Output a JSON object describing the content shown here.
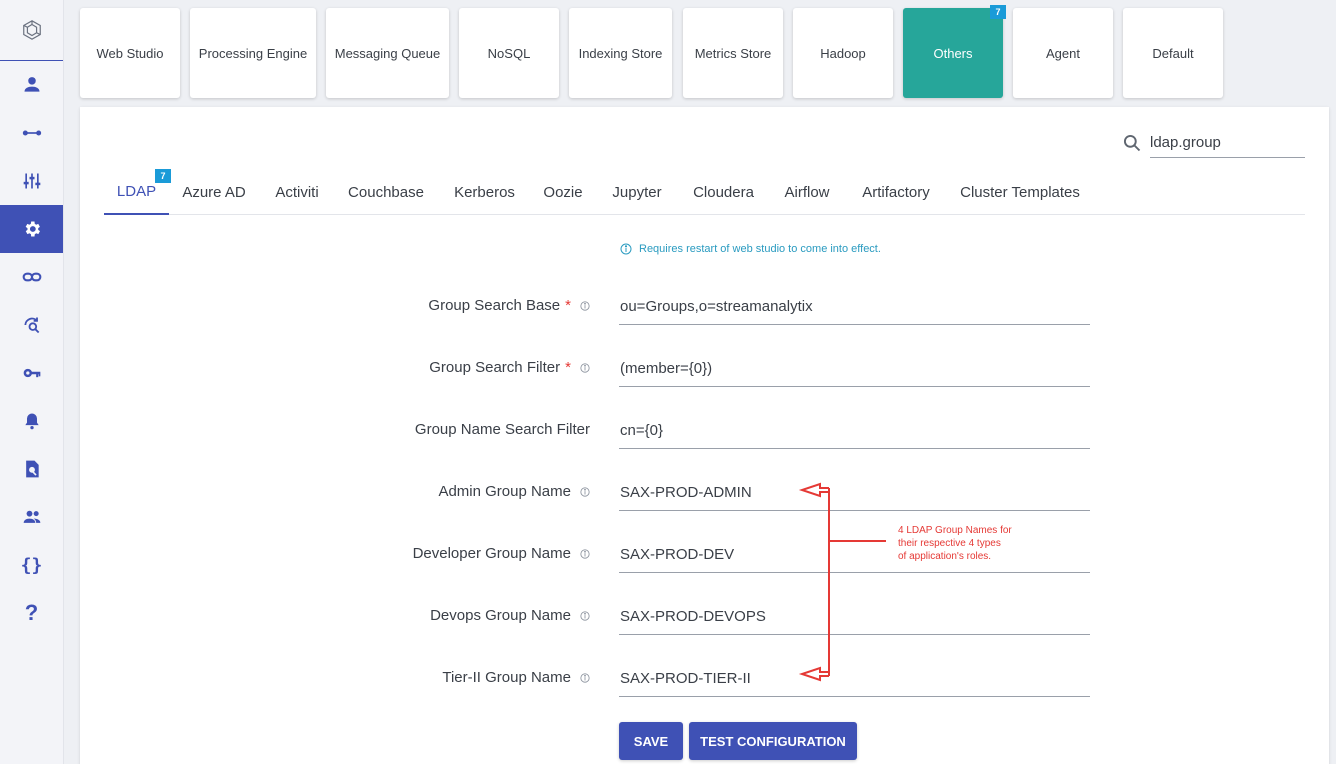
{
  "sidebar": {
    "logo_icon": "hexagon-logo",
    "items": [
      {
        "icon": "user-icon"
      },
      {
        "icon": "pipeline-icon"
      },
      {
        "icon": "sliders-icon"
      },
      {
        "icon": "gear-icon",
        "active": true
      },
      {
        "icon": "link-icon"
      },
      {
        "icon": "refresh-search-icon"
      },
      {
        "icon": "key-icon"
      },
      {
        "icon": "bell-icon"
      },
      {
        "icon": "document-search-icon"
      },
      {
        "icon": "users-icon"
      },
      {
        "icon": "braces-icon"
      },
      {
        "icon": "help-icon"
      }
    ]
  },
  "categories": [
    {
      "label": "Web Studio"
    },
    {
      "label": "Processing Engine"
    },
    {
      "label": "Messaging Queue"
    },
    {
      "label": "NoSQL"
    },
    {
      "label": "Indexing Store"
    },
    {
      "label": "Metrics Store"
    },
    {
      "label": "Hadoop"
    },
    {
      "label": "Others",
      "active": true,
      "badge": "7"
    },
    {
      "label": "Agent"
    },
    {
      "label": "Default"
    }
  ],
  "search": {
    "value": "ldap.group"
  },
  "tabs": [
    {
      "label": "LDAP",
      "active": true,
      "badge": "7"
    },
    {
      "label": "Azure AD"
    },
    {
      "label": "Activiti"
    },
    {
      "label": "Couchbase"
    },
    {
      "label": "Kerberos"
    },
    {
      "label": "Oozie"
    },
    {
      "label": "Jupyter"
    },
    {
      "label": "Cloudera"
    },
    {
      "label": "Airflow"
    },
    {
      "label": "Artifactory"
    },
    {
      "label": "Cluster Templates"
    }
  ],
  "notice": "Requires restart of web studio to come into effect.",
  "fields": [
    {
      "label": "Group Search Base",
      "required": "*",
      "value": "ou=Groups,o=streamanalytix"
    },
    {
      "label": "Group Search Filter",
      "required": "*",
      "value": "(member={0})"
    },
    {
      "label": "Group Name Search Filter",
      "value": "cn={0}"
    },
    {
      "label": "Admin Group Name",
      "value": "SAX-PROD-ADMIN"
    },
    {
      "label": "Developer Group Name",
      "value": "SAX-PROD-DEV"
    },
    {
      "label": "Devops Group Name",
      "value": "SAX-PROD-DEVOPS"
    },
    {
      "label": "Tier-II Group Name",
      "value": "SAX-PROD-TIER-II"
    }
  ],
  "annotation": {
    "line1": "4 LDAP Group Names for",
    "line2": "their respective 4 types",
    "line3": "of application's roles."
  },
  "buttons": {
    "save": "SAVE",
    "test": "TEST CONFIGURATION"
  },
  "colors": {
    "primary": "#3f51b5",
    "active_card": "#26a69a",
    "badge": "#1a9bd8",
    "required": "#e53935",
    "notice": "#2a9bc0"
  }
}
